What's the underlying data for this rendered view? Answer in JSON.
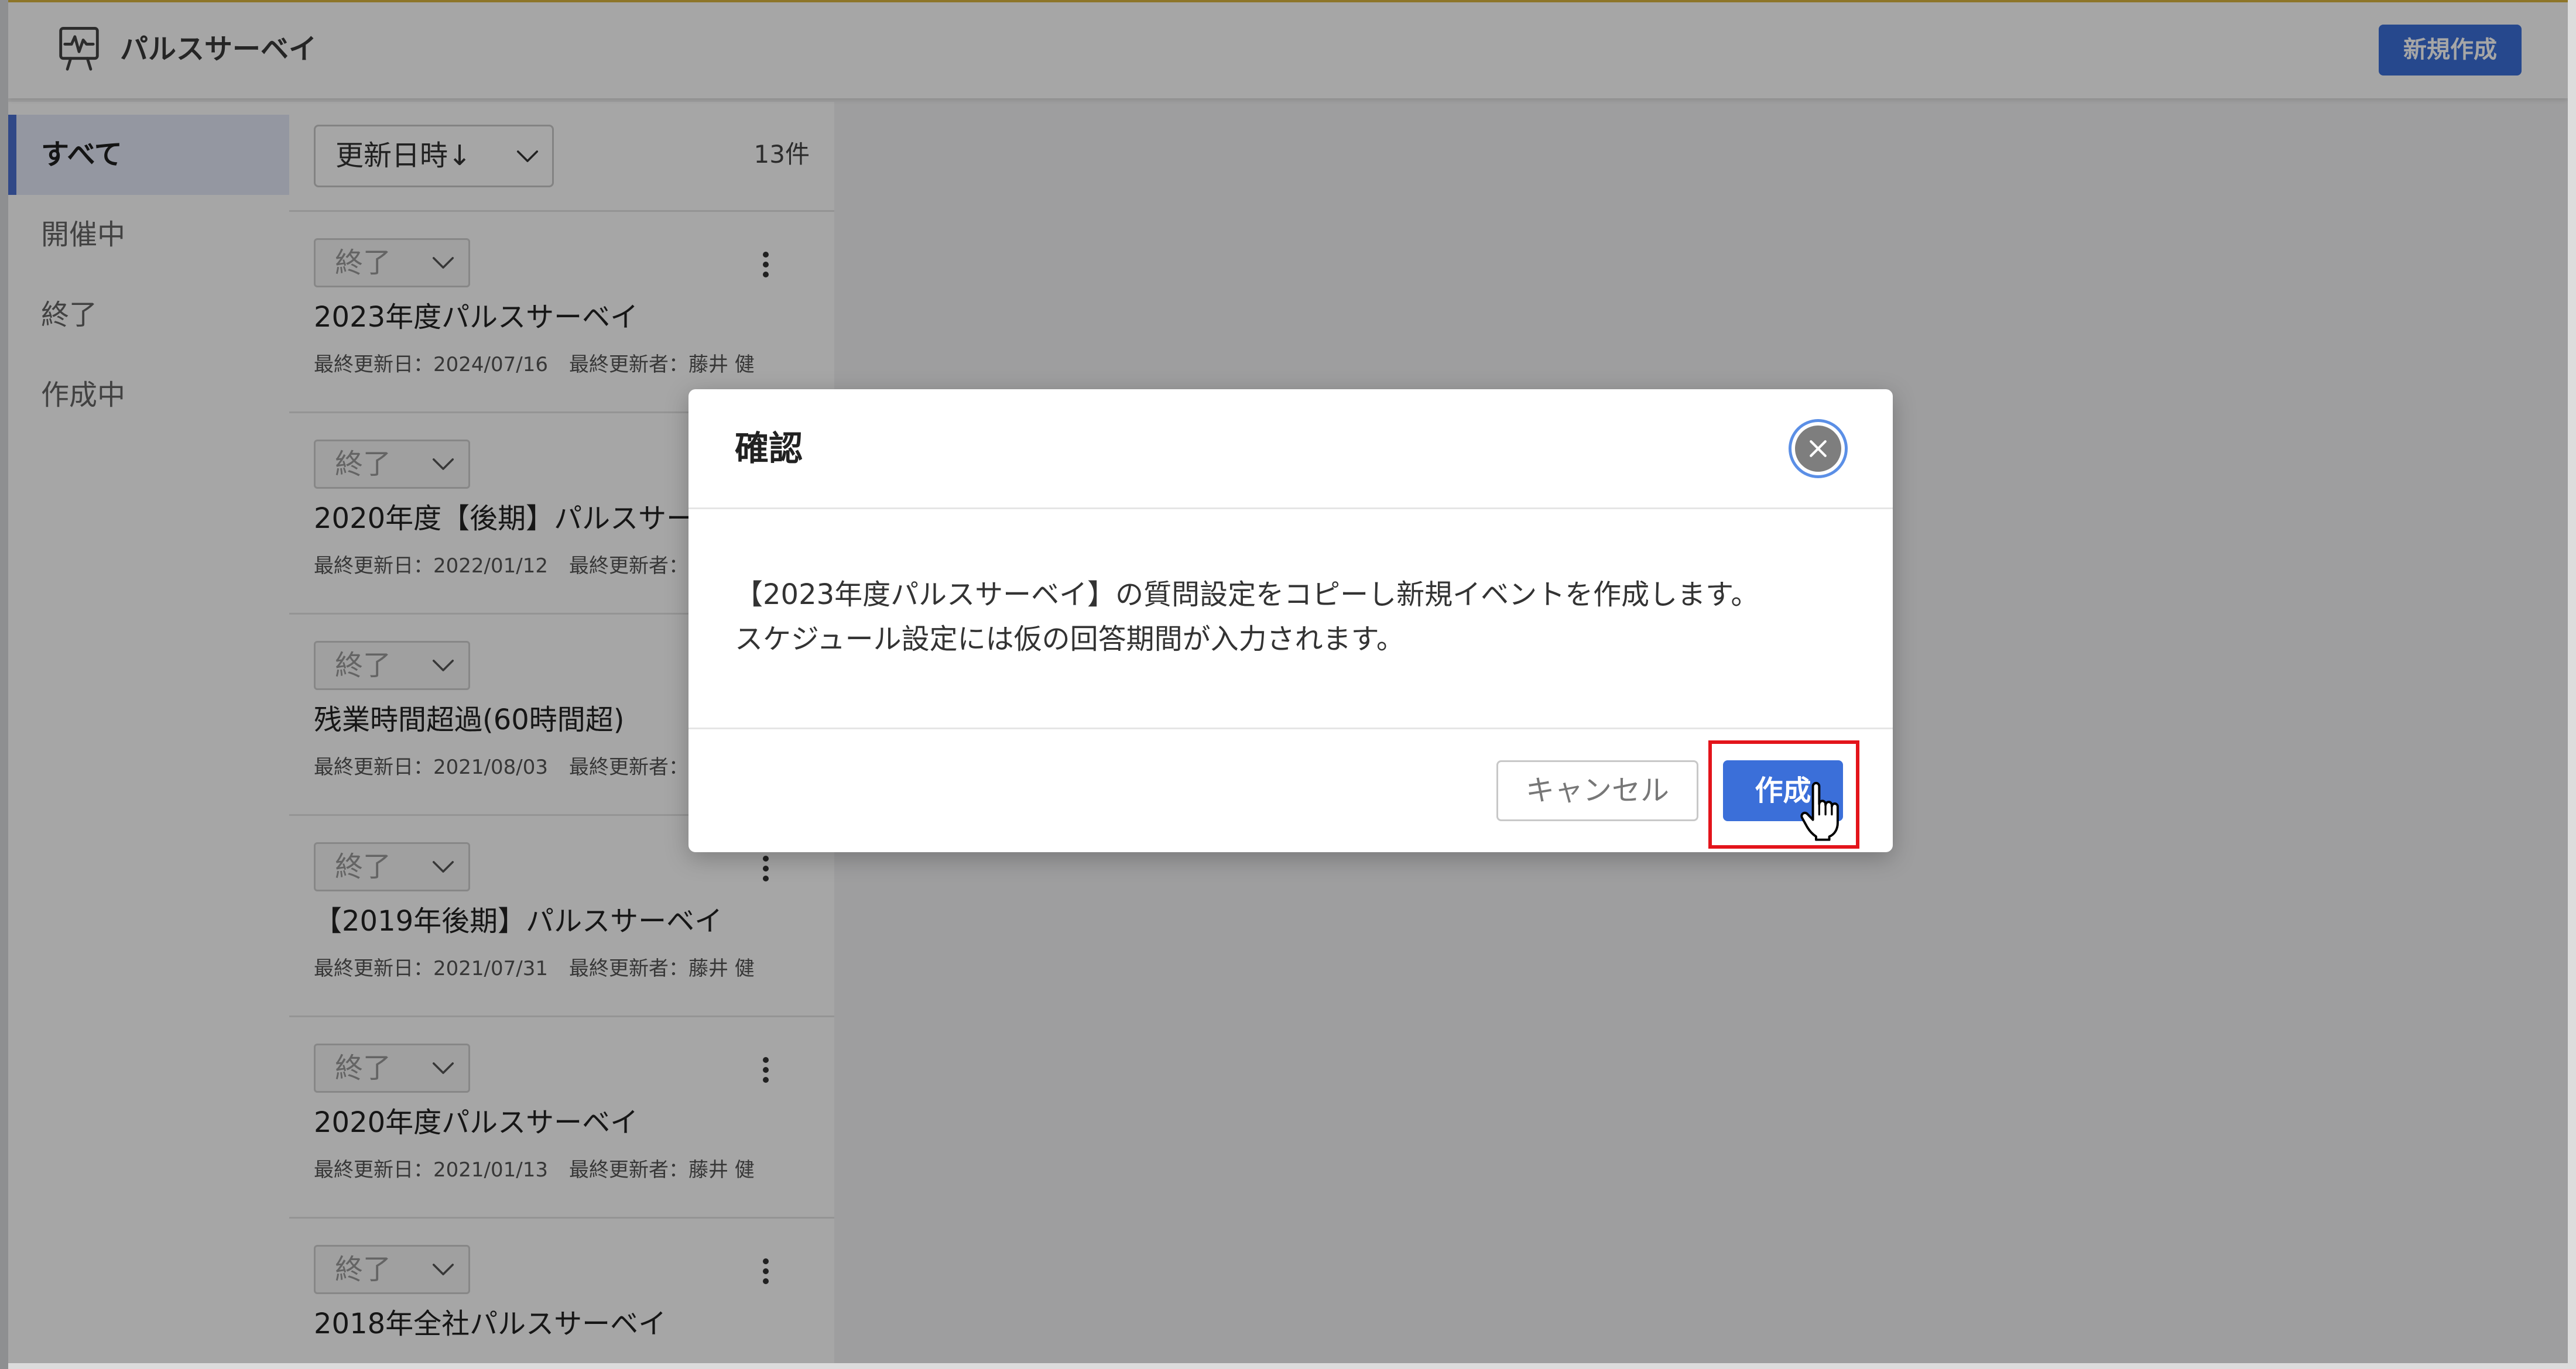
{
  "colors": {
    "accent": "#3b6fd9",
    "highlight": "#e3141b",
    "topline": "#d9b440",
    "nav_accent": "#4a6fcf"
  },
  "header": {
    "logo_icon": "pulse-monitor-icon",
    "title": "パルスサーベイ",
    "new_button_label": "新規作成"
  },
  "sidebar": {
    "items": [
      {
        "label": "すべて",
        "selected": true
      },
      {
        "label": "開催中",
        "selected": false
      },
      {
        "label": "終了",
        "selected": false
      },
      {
        "label": "作成中",
        "selected": false
      }
    ]
  },
  "list": {
    "sort_label": "更新日時↓",
    "count": "13件",
    "items": [
      {
        "status": "終了",
        "title": "2023年度パルスサーベイ",
        "updated": "最終更新日：2024/07/16",
        "updater": "最終更新者：藤井 健"
      },
      {
        "status": "終了",
        "title": "2020年度【後期】パルスサー",
        "updated": "最終更新日：2022/01/12",
        "updater": "最終更新者：藤"
      },
      {
        "status": "終了",
        "title": "残業時間超過(60時間超)",
        "updated": "最終更新日：2021/08/03",
        "updater": "最終更新者：藤"
      },
      {
        "status": "終了",
        "title": "【2019年後期】パルスサーベイ",
        "updated": "最終更新日：2021/07/31",
        "updater": "最終更新者：藤井 健"
      },
      {
        "status": "終了",
        "title": "2020年度パルスサーベイ",
        "updated": "最終更新日：2021/01/13",
        "updater": "最終更新者：藤井 健"
      },
      {
        "status": "終了",
        "title": "2018年全社パルスサーベイ"
      }
    ]
  },
  "modal": {
    "title": "確認",
    "message": [
      "【2023年度パルスサーベイ】の質問設定をコピーし新規イベントを作成します。",
      "スケジュール設定には仮の回答期間が入力されます。"
    ],
    "cancel_label": "キャンセル",
    "create_label": "作成"
  }
}
